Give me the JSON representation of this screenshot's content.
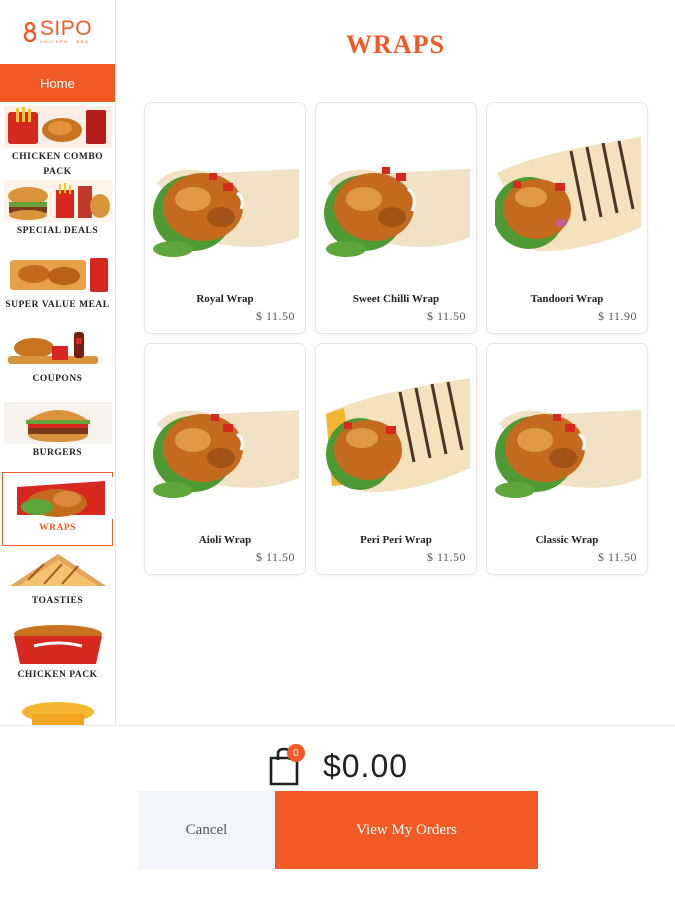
{
  "app": {
    "logo_text": "SIPO",
    "logo_sub": "CHICKEN · BBQ"
  },
  "sidebar": {
    "home_label": "Home",
    "categories": [
      {
        "label": "CHICKEN COMBO PACK",
        "icon": "combo-food-icon"
      },
      {
        "label": "SPECIAL DEALS",
        "icon": "burger-fries-icon"
      },
      {
        "label": "SUPER VALUE MEAL",
        "icon": "value-meal-icon"
      },
      {
        "label": "COUPONS",
        "icon": "coupon-food-icon"
      },
      {
        "label": "BURGERS",
        "icon": "burger-icon"
      },
      {
        "label": "WRAPS",
        "icon": "wrap-icon",
        "active": true
      },
      {
        "label": "TOASTIES",
        "icon": "toastie-icon"
      },
      {
        "label": "CHICKEN PACK",
        "icon": "chicken-bucket-icon"
      }
    ]
  },
  "main": {
    "title": "WRAPS",
    "items": [
      {
        "name": "Royal Wrap",
        "price": "$ 11.50"
      },
      {
        "name": "Sweet Chilli Wrap",
        "price": "$ 11.50"
      },
      {
        "name": "Tandoori Wrap",
        "price": "$ 11.90"
      },
      {
        "name": "Aioli Wrap",
        "price": "$ 11.50"
      },
      {
        "name": "Peri Peri Wrap",
        "price": "$ 11.50"
      },
      {
        "name": "Classic Wrap",
        "price": "$ 11.50"
      }
    ]
  },
  "cart": {
    "count": "0",
    "total": "$0.00"
  },
  "actions": {
    "cancel_label": "Cancel",
    "orders_label": "View My Orders"
  },
  "colors": {
    "accent": "#f15a24"
  }
}
